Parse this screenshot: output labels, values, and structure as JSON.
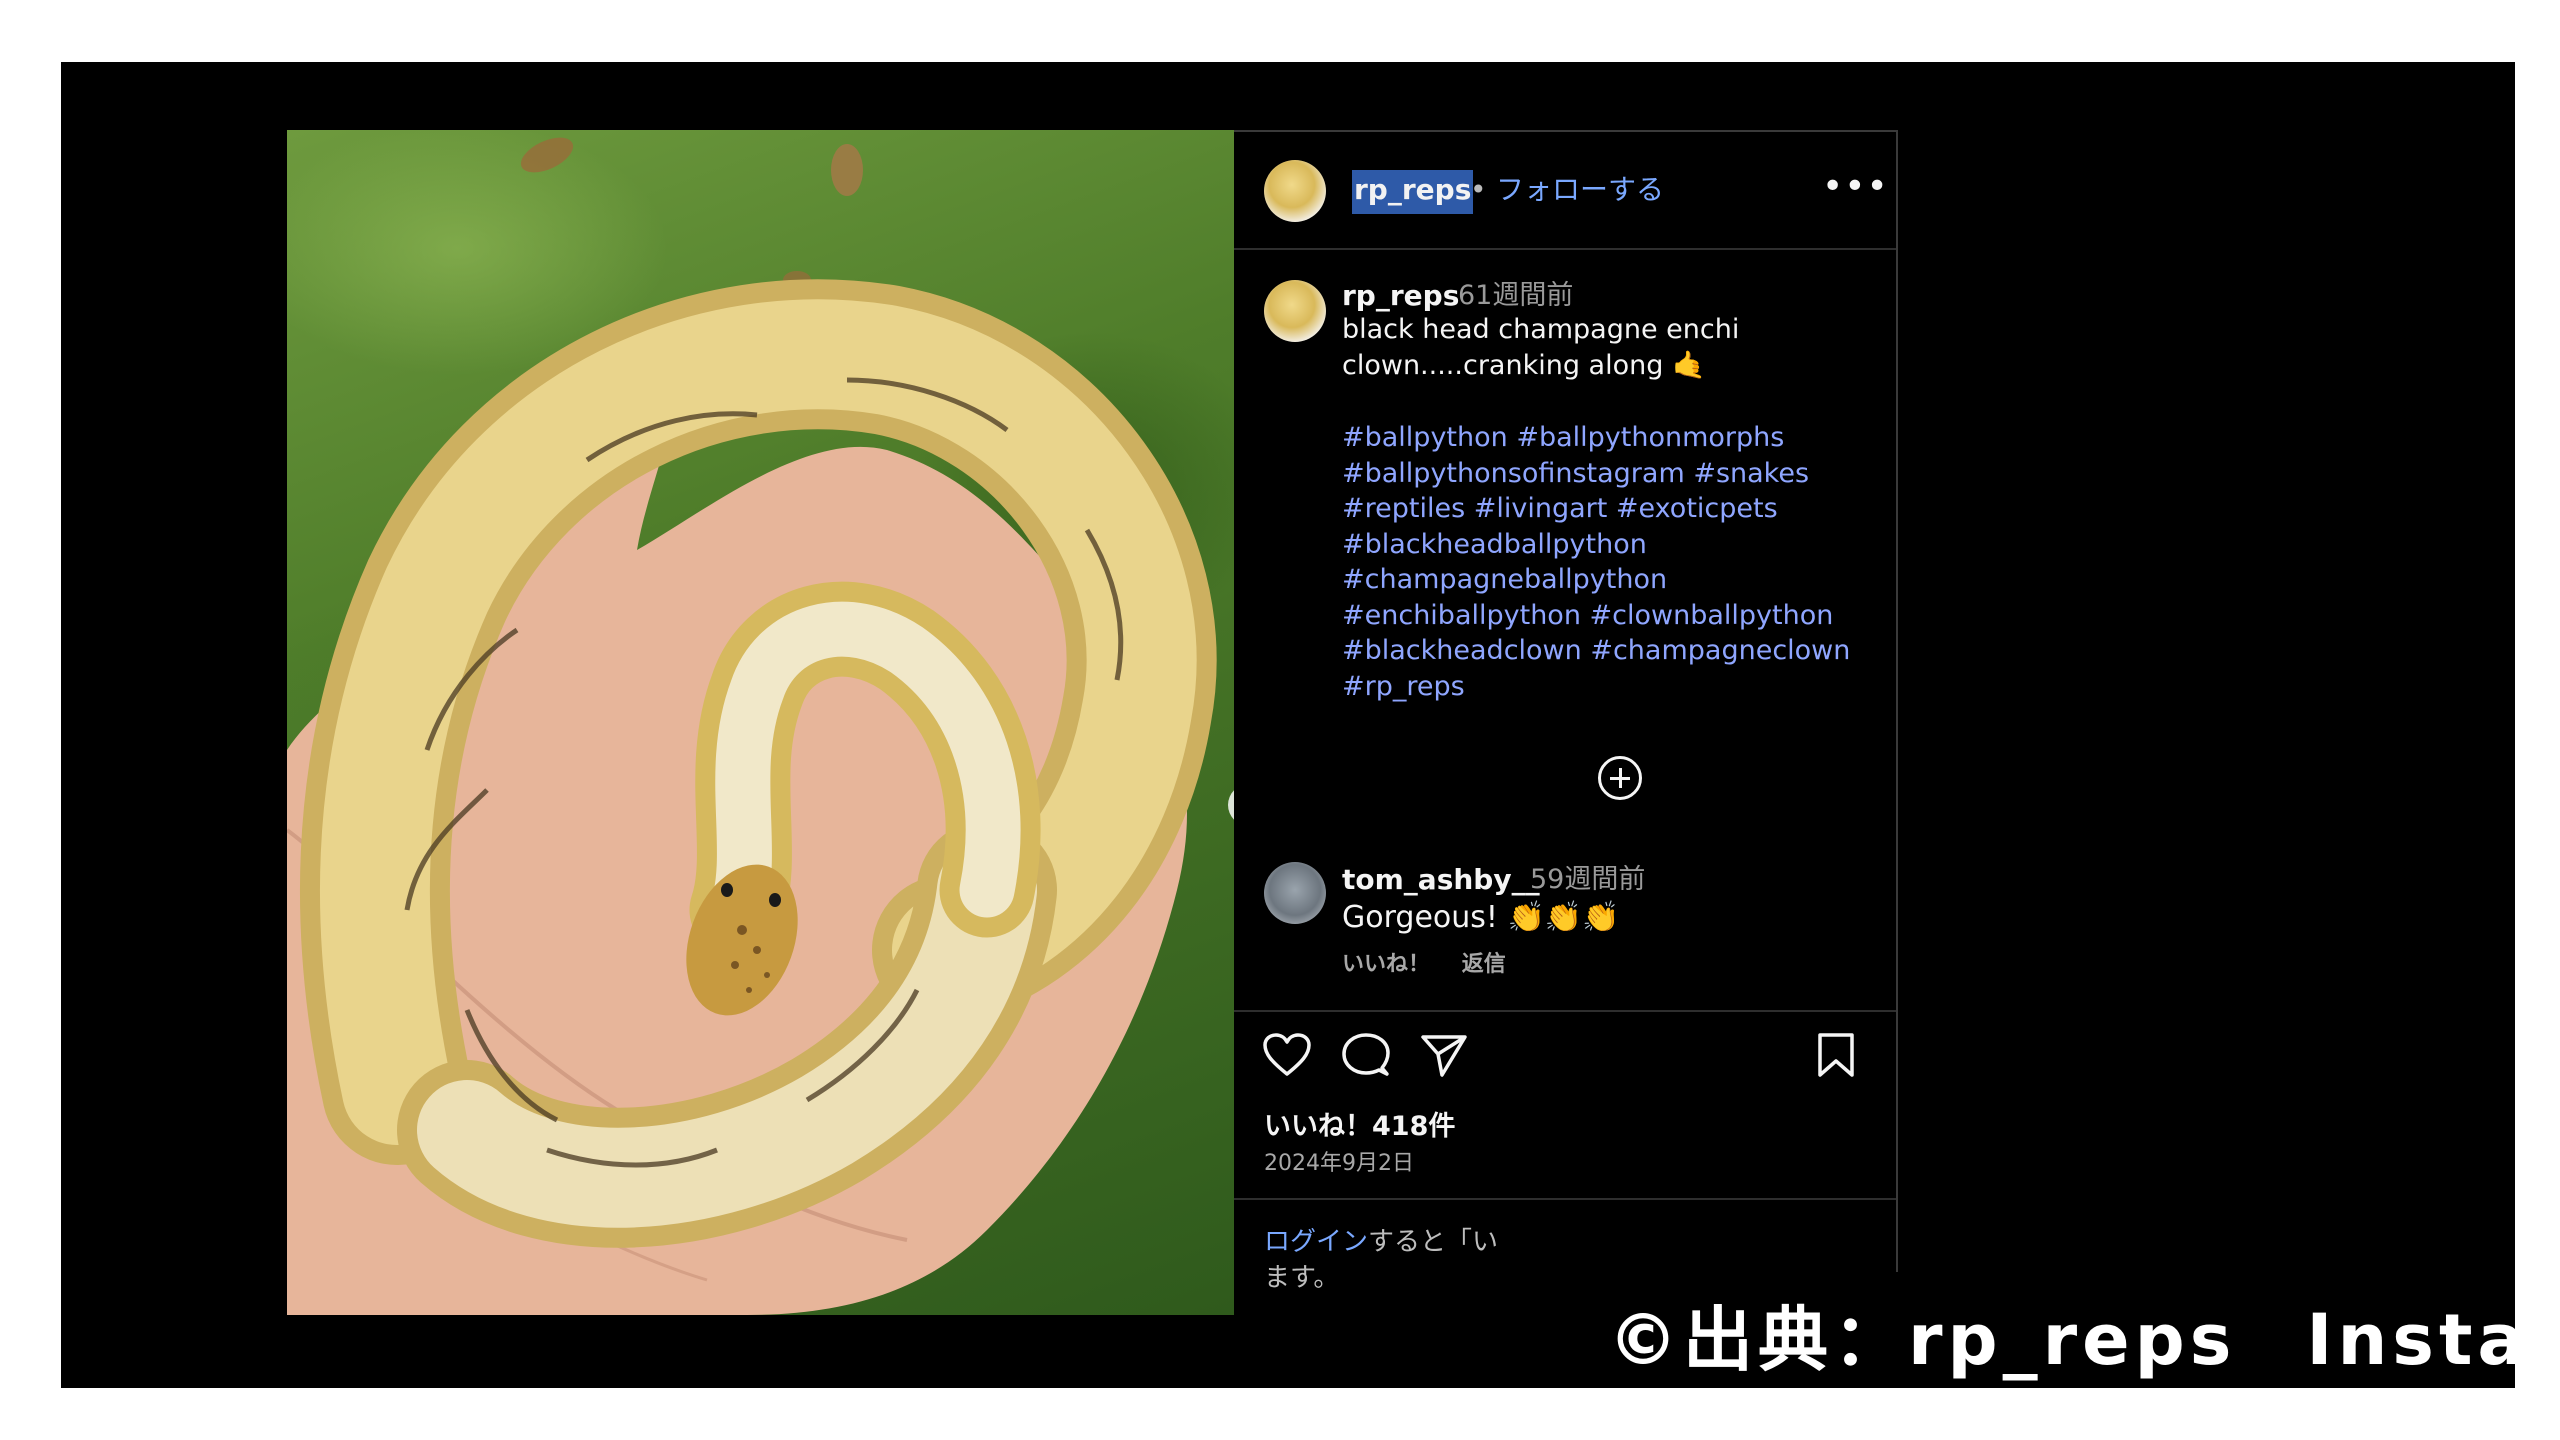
{
  "post": {
    "username": "rp_reps",
    "separator": "•",
    "follow_label": "フォローする",
    "more_label": "•••",
    "caption_time": "61週間前",
    "caption_lines": [
      "black head champagne enchi",
      "clown.....cranking along 🤙"
    ],
    "hashtag_lines": [
      "#ballpython #ballpythonmorphs",
      "#ballpythonsofinstagram #snakes",
      "#reptiles #livingart #exoticpets",
      "#blackheadballpython",
      "#champagneballpython",
      "#enchiballpython #clownballpython",
      "#blackheadclown #champagneclown",
      "#rp_reps"
    ],
    "load_more_icon": "plus-circle-icon",
    "likes": "いいね！418件",
    "date": "2024年9月2日",
    "login_link": "ログイン",
    "login_rest_line1": "すると「い",
    "login_line2": "ます。"
  },
  "comment": {
    "username": "tom_ashby__",
    "time": "59週間前",
    "text": "Gorgeous! 👏👏👏",
    "like_label": "いいね！",
    "reply_label": "返信"
  },
  "carousel": {
    "next_arrow": "›",
    "dot_count": 2
  },
  "credit": {
    "prefix": "©出典：rp_reps",
    "suffix": "Instagram"
  },
  "colors": {
    "background": "#000000",
    "link": "#7aa8ff",
    "hashtag": "#8fa6ff",
    "highlight": "#2e5aa8"
  }
}
